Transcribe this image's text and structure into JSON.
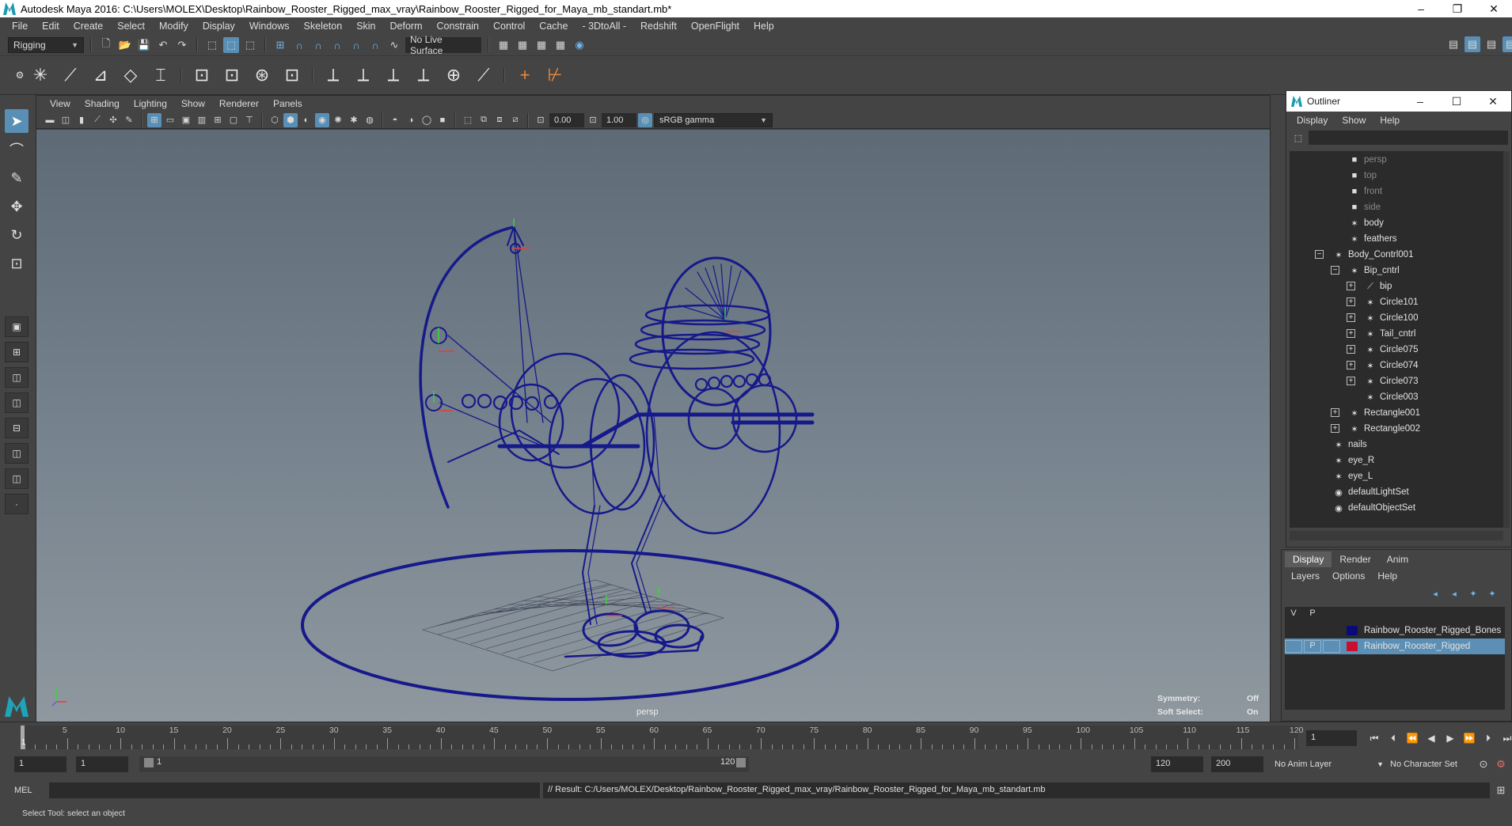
{
  "window": {
    "title": "Autodesk Maya 2016: C:\\Users\\MOLEX\\Desktop\\Rainbow_Rooster_Rigged_max_vray\\Rainbow_Rooster_Rigged_for_Maya_mb_standart.mb*",
    "min": "–",
    "restore": "❐",
    "close": "✕"
  },
  "menu": [
    "File",
    "Edit",
    "Create",
    "Select",
    "Modify",
    "Display",
    "Windows",
    "Skeleton",
    "Skin",
    "Deform",
    "Constrain",
    "Control",
    "Cache",
    "- 3DtoAll -",
    "Redshift",
    "OpenFlight",
    "Help"
  ],
  "status_line": {
    "menuset": "Rigging",
    "live_surface": "No Live Surface"
  },
  "panel": {
    "menu": [
      "View",
      "Shading",
      "Lighting",
      "Show",
      "Renderer",
      "Panels"
    ],
    "exposure": "0.00",
    "gamma": "1.00",
    "color_space": "sRGB gamma",
    "camera_label": "persp",
    "hud": {
      "symmetry_key": "Symmetry:",
      "symmetry_val": "Off",
      "soft_select_key": "Soft Select:",
      "soft_select_val": "On"
    },
    "wire_color": "#16198a"
  },
  "outliner": {
    "title": "Outliner",
    "menu": [
      "Display",
      "Show",
      "Help"
    ],
    "items": [
      {
        "label": "persp",
        "icon": "camera-icon",
        "dim": true
      },
      {
        "label": "top",
        "icon": "camera-icon",
        "dim": true
      },
      {
        "label": "front",
        "icon": "camera-icon",
        "dim": true
      },
      {
        "label": "side",
        "icon": "camera-icon",
        "dim": true
      },
      {
        "label": "body",
        "icon": "transform-icon",
        "dim": false
      },
      {
        "label": "feathers",
        "icon": "transform-icon",
        "dim": false
      },
      {
        "label": "Body_Contrl001",
        "icon": "transform-icon",
        "dim": false
      },
      {
        "label": "Bip_cntrl",
        "icon": "transform-icon",
        "dim": false
      },
      {
        "label": "bip",
        "icon": "joint-icon",
        "dim": false
      },
      {
        "label": "Circle101",
        "icon": "transform-icon",
        "dim": false
      },
      {
        "label": "Circle100",
        "icon": "transform-icon",
        "dim": false
      },
      {
        "label": "Tail_cntrl",
        "icon": "transform-icon",
        "dim": false
      },
      {
        "label": "Circle075",
        "icon": "transform-icon",
        "dim": false
      },
      {
        "label": "Circle074",
        "icon": "transform-icon",
        "dim": false
      },
      {
        "label": "Circle073",
        "icon": "transform-icon",
        "dim": false
      },
      {
        "label": "Circle003",
        "icon": "transform-icon",
        "dim": false
      },
      {
        "label": "Rectangle001",
        "icon": "transform-icon",
        "dim": false
      },
      {
        "label": "Rectangle002",
        "icon": "transform-icon",
        "dim": false
      },
      {
        "label": "nails",
        "icon": "transform-icon",
        "dim": false
      },
      {
        "label": "eye_R",
        "icon": "transform-icon",
        "dim": false
      },
      {
        "label": "eye_L",
        "icon": "transform-icon",
        "dim": false
      },
      {
        "label": "defaultLightSet",
        "icon": "set-icon",
        "dim": false
      },
      {
        "label": "defaultObjectSet",
        "icon": "set-icon",
        "dim": false
      }
    ]
  },
  "layer_editor": {
    "tabs": [
      "Display",
      "Render",
      "Anim"
    ],
    "menu": [
      "Layers",
      "Options",
      "Help"
    ],
    "header_v": "V",
    "header_p": "P",
    "layers": [
      {
        "name": "Rainbow_Rooster_Rigged_Bones",
        "color": "#0a0a7a",
        "v": "",
        "p": "",
        "selected": false
      },
      {
        "name": "Rainbow_Rooster_Rigged",
        "color": "#c8102e",
        "v": "",
        "p": "P",
        "selected": true
      }
    ]
  },
  "time_slider": {
    "ticks": [
      "5",
      "10",
      "15",
      "20",
      "25",
      "30",
      "35",
      "40",
      "45",
      "50",
      "55",
      "60",
      "65",
      "70",
      "75",
      "80",
      "85",
      "90",
      "95",
      "100",
      "105",
      "110",
      "115",
      "120"
    ],
    "current_frame": "1",
    "current_label": "1"
  },
  "range_slider": {
    "start": "1",
    "playback_start": "1",
    "range_start_label": "1",
    "range_end_label": "120",
    "playback_end": "120",
    "end": "200",
    "anim_layer": "No Anim Layer",
    "character_set": "No Character Set"
  },
  "command_line": {
    "language": "MEL",
    "result": "// Result: C:/Users/MOLEX/Desktop/Rainbow_Rooster_Rigged_max_vray/Rainbow_Rooster_Rigged_for_Maya_mb_standart.mb"
  },
  "help_line": "Select Tool: select an object"
}
